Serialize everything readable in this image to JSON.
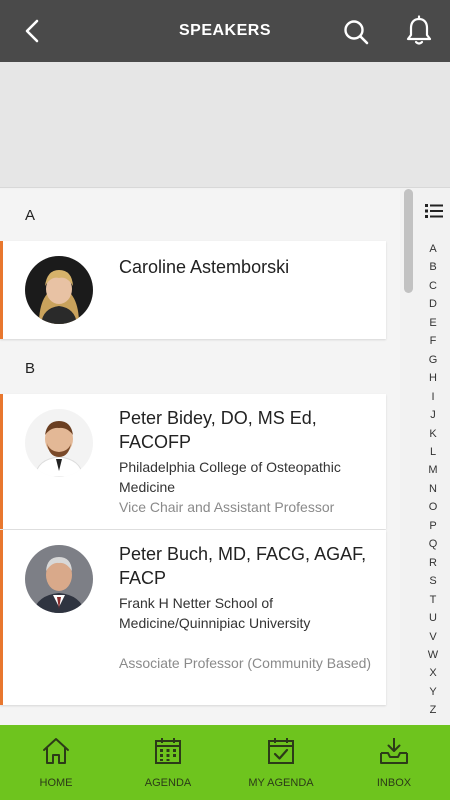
{
  "header": {
    "title": "SPEAKERS",
    "back_icon": "back-arrow-icon",
    "search_icon": "search-icon",
    "notification_icon": "bell-icon"
  },
  "sections": [
    {
      "letter": "A",
      "speakers": [
        {
          "name": "Caroline Astemborski",
          "organization": "",
          "role": ""
        }
      ]
    },
    {
      "letter": "B",
      "speakers": [
        {
          "name": "Peter Bidey, DO, MS Ed, FACOFP",
          "organization": "Philadelphia College of Osteopathic Medicine",
          "role": "Vice Chair and Assistant Professor"
        },
        {
          "name": "Peter Buch, MD, FACG, AGAF, FACP",
          "organization": "Frank H Netter School of Medicine/Quinnipiac University",
          "role": "Associate Professor (Community Based)"
        }
      ]
    }
  ],
  "index": {
    "icon": "list-icon",
    "letters": [
      "A",
      "B",
      "C",
      "D",
      "E",
      "F",
      "G",
      "H",
      "I",
      "J",
      "K",
      "L",
      "M",
      "N",
      "O",
      "P",
      "Q",
      "R",
      "S",
      "T",
      "U",
      "V",
      "W",
      "X",
      "Y",
      "Z"
    ]
  },
  "bottom_nav": [
    {
      "label": "HOME",
      "icon": "home-icon"
    },
    {
      "label": "AGENDA",
      "icon": "calendar-icon"
    },
    {
      "label": "MY AGENDA",
      "icon": "calendar-check-icon"
    },
    {
      "label": "INBOX",
      "icon": "inbox-icon"
    }
  ],
  "colors": {
    "header_bg": "#4a4a4a",
    "accent": "#e8772e",
    "bottom_nav_bg": "#6ec41e"
  }
}
